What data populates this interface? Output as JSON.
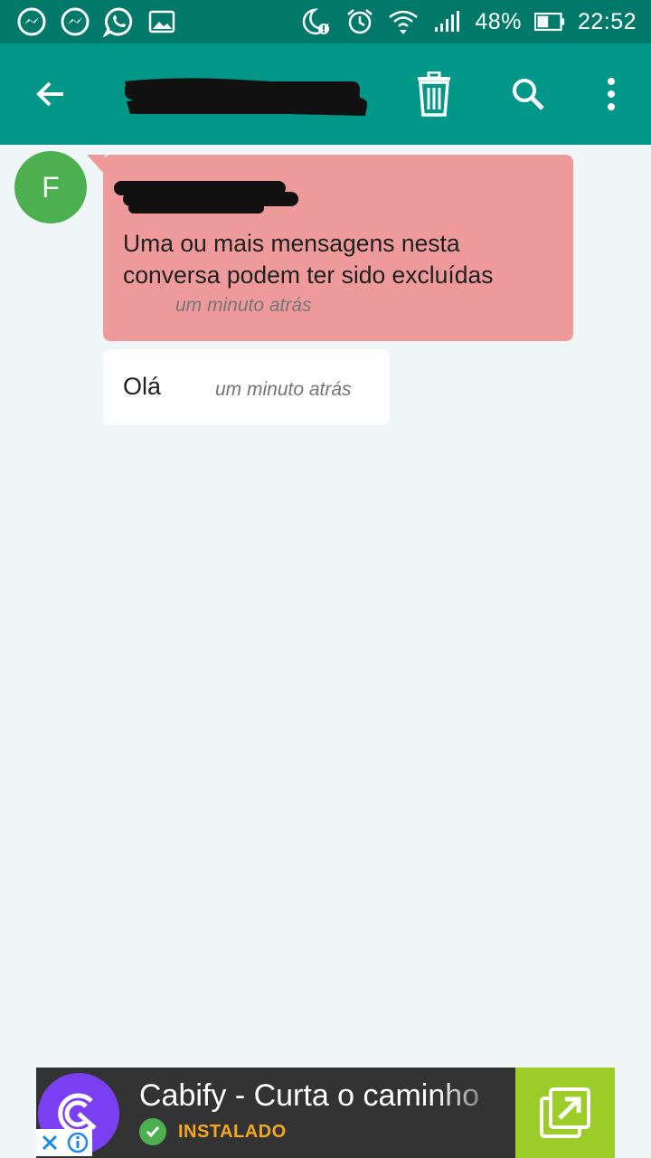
{
  "status_bar": {
    "notification_icons": [
      "messenger-icon",
      "messenger-icon",
      "whatsapp-icon",
      "image-icon"
    ],
    "system_icons": [
      "do-not-disturb-icon",
      "alarm-icon",
      "wifi-icon",
      "signal-icon",
      "battery-icon"
    ],
    "battery_percent": "48%",
    "time": "22:52"
  },
  "toolbar": {
    "back_icon": "arrow-left-icon",
    "title": "",
    "delete_icon": "trash-icon",
    "search_icon": "search-icon",
    "more_icon": "more-vert-icon",
    "color": "#009688"
  },
  "conversation": {
    "avatar_initial": "F",
    "avatar_color": "#4caf50",
    "messages": [
      {
        "sender": "",
        "text": "Uma ou mais mensagens nesta conversa podem ter sido excluídas",
        "time": "um minuto atrás",
        "color": "#ef9a9a"
      },
      {
        "text": "Olá",
        "time": "um minuto atrás",
        "color": "#ffffff"
      }
    ]
  },
  "ad": {
    "title": "Cabify - Curta o caminho",
    "status": "INSTALADO",
    "brand_color": "#7b3ff2",
    "button_color": "#9ccc28"
  }
}
